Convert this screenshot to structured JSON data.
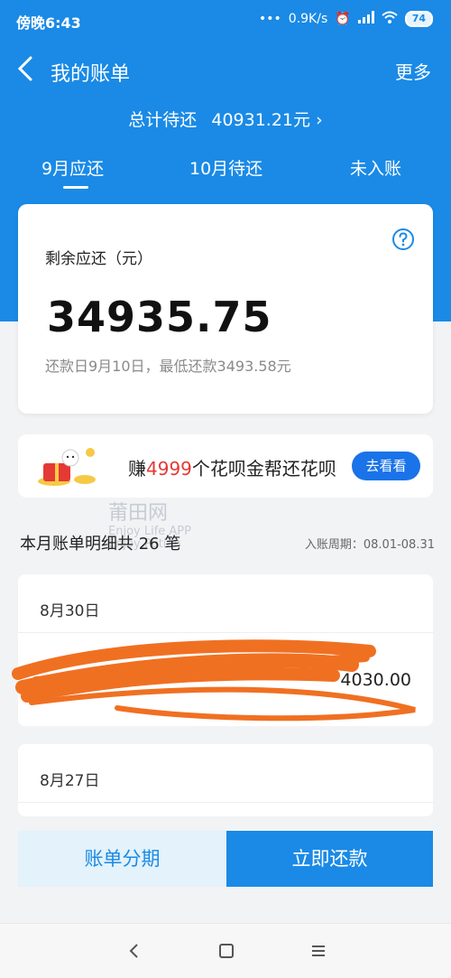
{
  "status": {
    "time": "傍晚6:43",
    "speed": "0.9K/s",
    "battery": "74"
  },
  "nav": {
    "title": "我的账单",
    "more": "更多"
  },
  "total": {
    "label": "总计待还",
    "amount": "40931.21元",
    "arrow": "›"
  },
  "tabs": [
    {
      "label": "9月应还"
    },
    {
      "label": "10月待还"
    },
    {
      "label": "未入账"
    }
  ],
  "summary": {
    "label": "剩余应还（元）",
    "amount": "34935.75",
    "due_text": "还款日9月10日，最低还款3493.58元"
  },
  "promo": {
    "prefix": "赚",
    "highlight": "4999",
    "suffix": "个花呗金帮还花呗",
    "button": "去看看"
  },
  "bill": {
    "title": "本月账单明细共 26 笔",
    "cycle": "入账周期：08.01-08.31"
  },
  "days": [
    {
      "date": "8月30日",
      "amount": "4030.00"
    },
    {
      "date": "8月27日"
    }
  ],
  "watermark": {
    "line1": "莆田网",
    "line2": "Enjoy Life  APP",
    "line3": "Enjoy Putian"
  },
  "actions": {
    "installment": "账单分期",
    "pay_now": "立即还款"
  },
  "colors": {
    "primary": "#1a8ae6",
    "highlight": "#e53935",
    "scribble": "#f07022"
  }
}
